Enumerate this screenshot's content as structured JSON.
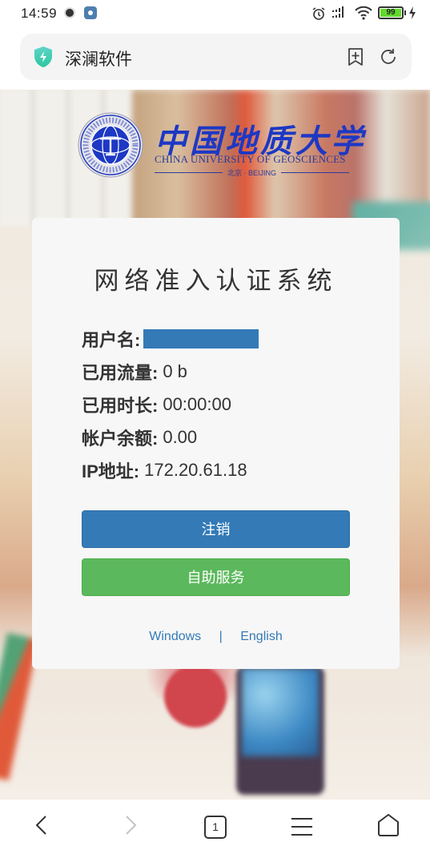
{
  "status_bar": {
    "time": "14:59",
    "battery_level": "99",
    "icons": [
      "clock-app-icon",
      "settings-app-icon",
      "alarm-icon",
      "signal-icon",
      "wifi-icon",
      "battery-icon",
      "charging-icon"
    ]
  },
  "url_bar": {
    "title": "深澜软件",
    "icons": [
      "shield-icon",
      "bookmark-add-icon",
      "reload-icon"
    ]
  },
  "logo": {
    "name_cn": "中国地质大学",
    "name_en": "CHINA UNIVERSITY OF GEOSCIENCES",
    "location": "北京 · BEIJING"
  },
  "card": {
    "title": "网络准入认证系统",
    "info": [
      {
        "label": "用户名:",
        "value": ""
      },
      {
        "label": "已用流量:",
        "value": "0 b"
      },
      {
        "label": "已用时长:",
        "value": "00:00:00"
      },
      {
        "label": "帐户余额:",
        "value": "0.00"
      },
      {
        "label": "IP地址:",
        "value": "172.20.61.18"
      }
    ],
    "logout_label": "注销",
    "self_service_label": "自助服务",
    "links": {
      "windows": "Windows",
      "separator": "|",
      "english": "English"
    }
  },
  "bottom_nav": {
    "tab_count": "1",
    "items": [
      "back",
      "forward",
      "tabs",
      "menu",
      "home"
    ]
  },
  "colors": {
    "primary": "#337ab7",
    "success": "#5cb85c",
    "card_bg": "#f7f7f7",
    "logo_blue": "#1d38c4"
  }
}
